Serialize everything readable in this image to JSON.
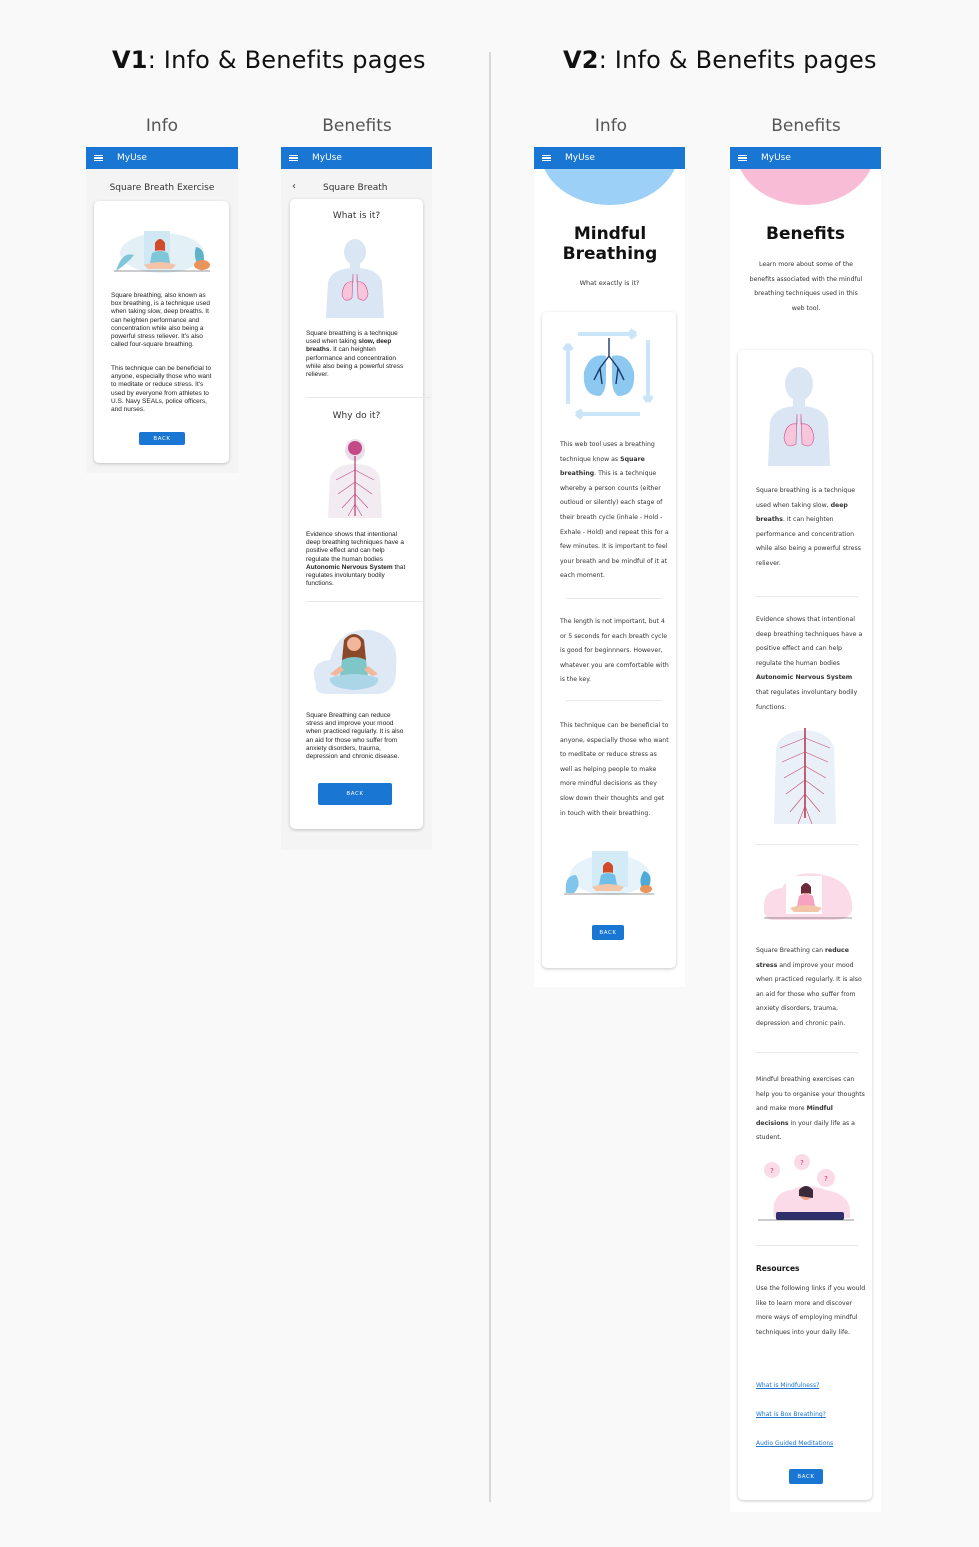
{
  "titles": {
    "v1_prefix": "V1",
    "v1_rest": ": Info & Benefits pages",
    "v2_prefix": "V2",
    "v2_rest": ": Info & Benefits pages"
  },
  "column_labels": {
    "v1_info": "Info",
    "v1_benefits": "Benefits",
    "v2_info": "Info",
    "v2_benefits": "Benefits"
  },
  "app": {
    "name": "MyUse"
  },
  "v1_info": {
    "heading": "Square Breath Exercise",
    "paragraph1": "Square breathing, also known as box breathing, is a technique used when taking slow, deep breaths. It can heighten performance and concentration while also being a powerful stress reliever. It's also called four-square breathing.",
    "paragraph2": "This technique can be beneficial to anyone, especially those who want to meditate or reduce stress. It's used by everyone from athletes to U.S. Navy SEALs, police officers, and nurses.",
    "back_label": "BACK"
  },
  "v1_benefits": {
    "heading": "Square Breath",
    "back_chevron": "‹",
    "what_heading": "What is it?",
    "what_text_a": "Square breathing is a technique used when taking ",
    "what_text_bold": "slow, deep breaths",
    "what_text_b": ". It can heighten performance and concentration while also being a powerful stress reliever.",
    "why_heading": "Why do it?",
    "why_text_a": "Evidence shows that intentional deep breathing techniques have a positive effect and can help regulate the human bodies ",
    "why_text_bold": "Autonomic Nervous System",
    "why_text_b": " that regulates involuntary bodily functions.",
    "stress_text": "Square Breathing can reduce stress and improve your mood when practiced regularly. It is also an aid for those who suffer from anxiety disorders, trauma, depression and chronic disease.",
    "back_label": "BACK"
  },
  "v2_info": {
    "title": "Mindful Breathing",
    "subtitle": "What exactly is it?",
    "p1_a": "This web tool uses a breathing technique know as ",
    "p1_bold": "Square breathing",
    "p1_b": ". This is a technique whereby a person counts (either outloud or silently) each stage of their breath cycle (inhale - Hold - Exhale - Hold) and repeat this for a few minutes. It is important to feel your breath and be mindful of it at each moment.",
    "p2": "The length is not important, but 4 or 5 seconds for each breath cycle is good for beginnners. However, whatever you are comfortable with is the key.",
    "p3": "This technique can be beneficial to anyone, especially those who want to meditate or reduce stress as well as helping people to make more mindful decisions as they slow down their thoughts and get in touch with their breathing.",
    "back_label": "BACK",
    "accent_color": "#9cd0f7"
  },
  "v2_benefits": {
    "title": "Benefits",
    "intro": "Learn more about some of the benefits associated with the mindful breathing techniques used in this web tool.",
    "b1_a": "Square breathing is a technique used when taking slow, ",
    "b1_bold": "deep breaths",
    "b1_b": ". It can heighten performance and concentration while also being a powerful stress reliever.",
    "b2_a": "Evidence shows that intentional deep breathing techniques have a positive effect and can help regulate the human bodies ",
    "b2_bold": "Autonomic Nervous System",
    "b2_b": " that regulates involuntary bodily functions.",
    "b3_a": "Square Breathing can ",
    "b3_bold": "reduce stress",
    "b3_b": " and improve your mood when practiced regularly. It is also an aid for those who suffer from anxiety disorders, trauma, depression and chronic pain.",
    "b4_a": "Mindful breathing exercises can help you to organise your thoughts and make more ",
    "b4_bold": "Mindful decisions",
    "b4_b": " in your daily life as a student.",
    "resources_heading": "Resources",
    "resources_text": "Use the following links if you would like to learn more and discover more ways of employing mindful techniques into your daily life.",
    "links": [
      "What is Mindfulness?",
      "What is Box Breathing?",
      "Audio Guided Meditations"
    ],
    "back_label": "BACK",
    "accent_color": "#f8bcd6"
  }
}
